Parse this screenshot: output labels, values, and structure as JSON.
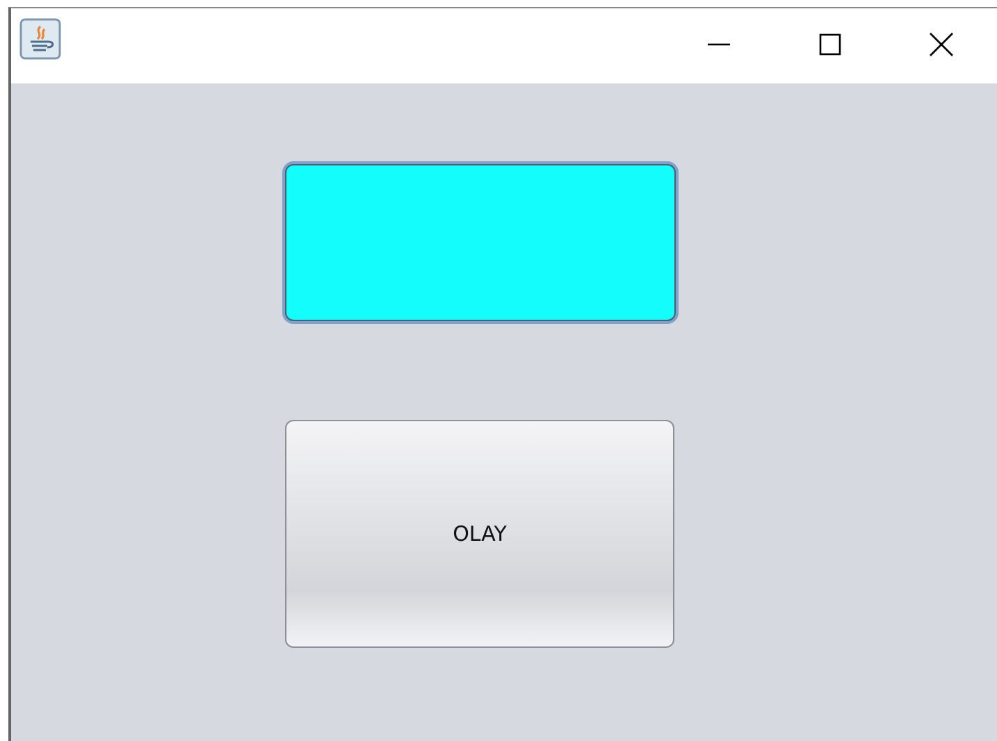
{
  "window": {
    "controls": [
      {
        "kind": "minimize"
      },
      {
        "kind": "maximize"
      },
      {
        "kind": "close"
      }
    ]
  },
  "buttons": [
    {
      "kind": "color",
      "color": "#14fdfd",
      "focused": true
    },
    {
      "kind": "text",
      "label": "OLAY",
      "focused": false
    }
  ]
}
